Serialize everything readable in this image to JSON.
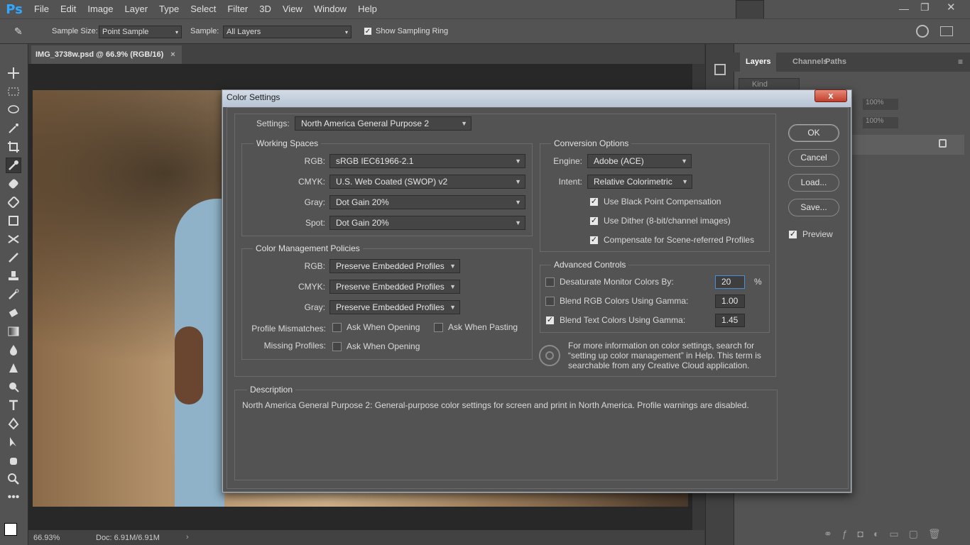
{
  "app": {
    "logo": "Ps"
  },
  "menu": [
    "File",
    "Edit",
    "Image",
    "Layer",
    "Type",
    "Select",
    "Filter",
    "3D",
    "View",
    "Window",
    "Help"
  ],
  "options_bar": {
    "sample_size_label": "Sample Size:",
    "sample_size_value": "Point Sample",
    "sample_label": "Sample:",
    "sample_value": "All Layers",
    "show_ring_label": "Show Sampling Ring",
    "show_ring_checked": true
  },
  "document": {
    "tab_title": "IMG_3738w.psd @ 66.9% (RGB/16)",
    "tab_close": "×",
    "zoom": "66.93%",
    "doc_size": "Doc: 6.91M/6.91M"
  },
  "panels": {
    "tabs": [
      "Layers",
      "Channels",
      "Paths"
    ],
    "kind_placeholder": "Kind",
    "opacity": "100%",
    "fill": "100%"
  },
  "dialog": {
    "title": "Color Settings",
    "close": "x",
    "settings_label": "Settings:",
    "settings_value": "North America General Purpose 2",
    "working_spaces": {
      "title": "Working Spaces",
      "rows": [
        {
          "label": "RGB:",
          "value": "sRGB IEC61966-2.1"
        },
        {
          "label": "CMYK:",
          "value": "U.S. Web Coated (SWOP) v2"
        },
        {
          "label": "Gray:",
          "value": "Dot Gain 20%"
        },
        {
          "label": "Spot:",
          "value": "Dot Gain 20%"
        }
      ]
    },
    "policies": {
      "title": "Color Management Policies",
      "rows": [
        {
          "label": "RGB:",
          "value": "Preserve Embedded Profiles"
        },
        {
          "label": "CMYK:",
          "value": "Preserve Embedded Profiles"
        },
        {
          "label": "Gray:",
          "value": "Preserve Embedded Profiles"
        }
      ],
      "mismatch_label": "Profile Mismatches:",
      "mismatch_open": "Ask When Opening",
      "mismatch_paste": "Ask When Pasting",
      "missing_label": "Missing Profiles:",
      "missing_open": "Ask When Opening"
    },
    "conversion": {
      "title": "Conversion Options",
      "engine_label": "Engine:",
      "engine_value": "Adobe (ACE)",
      "intent_label": "Intent:",
      "intent_value": "Relative Colorimetric",
      "black_point": "Use Black Point Compensation",
      "dither": "Use Dither (8-bit/channel images)",
      "scene": "Compensate for Scene-referred Profiles"
    },
    "advanced": {
      "title": "Advanced Controls",
      "desaturate_label": "Desaturate Monitor Colors By:",
      "desaturate_value": "20",
      "desaturate_unit": "%",
      "blend_rgb_label": "Blend RGB Colors Using Gamma:",
      "blend_rgb_value": "1.00",
      "blend_text_label": "Blend Text Colors Using Gamma:",
      "blend_text_value": "1.45"
    },
    "info": {
      "line1": "For more information on color settings, search for",
      "line2": "“setting up color management” in Help. This term is",
      "line3": "searchable from any Creative Cloud application."
    },
    "description": {
      "title": "Description",
      "text": "North America General Purpose 2:  General-purpose color settings for screen and print in North America. Profile warnings are disabled."
    },
    "buttons": {
      "ok": "OK",
      "cancel": "Cancel",
      "load": "Load...",
      "save": "Save...",
      "preview": "Preview"
    }
  },
  "colors": {
    "accent": "#31a8ff",
    "ui_bg": "#535353",
    "dark_bg": "#282828"
  }
}
